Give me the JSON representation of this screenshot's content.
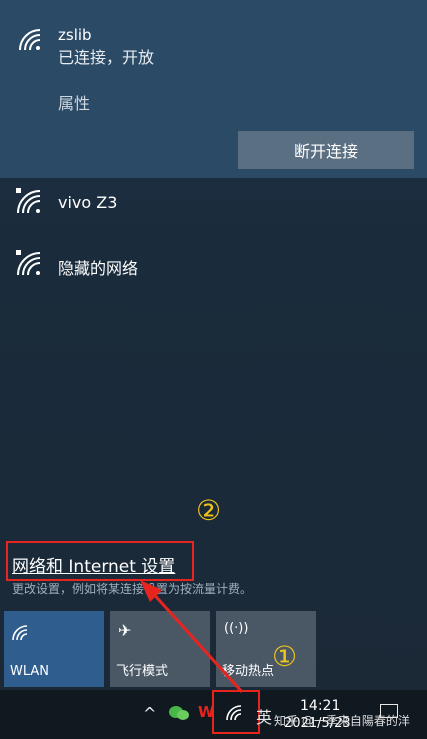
{
  "connected": {
    "ssid": "zslib",
    "status": "已连接，开放",
    "properties_label": "属性",
    "disconnect_label": "断开连接"
  },
  "networks": [
    {
      "ssid": "vivo Z3",
      "icon": "wifi-secured-icon"
    },
    {
      "ssid": "隐藏的网络",
      "icon": "wifi-secured-icon"
    }
  ],
  "settings": {
    "link_label": "网络和 Internet 设置",
    "subtitle": "更改设置，例如将某连接设置为按流量计费。"
  },
  "quick_actions": [
    {
      "label": "WLAN",
      "icon": "wifi-icon",
      "active": true
    },
    {
      "label": "飞行模式",
      "icon": "airplane-icon",
      "active": false
    },
    {
      "label": "移动热点",
      "icon": "hotspot-icon",
      "active": false
    }
  ],
  "annotations": {
    "step1": "①",
    "step2": "②"
  },
  "taskbar": {
    "ime_label": "英",
    "time": "14:21",
    "date": "2021/5/23",
    "watermark": "知乎 @一季来自陽春的洋"
  },
  "colors": {
    "accent_active": "#2f5e8e",
    "annotation_red": "#e8241f",
    "annotation_yellow": "#f0c419"
  }
}
